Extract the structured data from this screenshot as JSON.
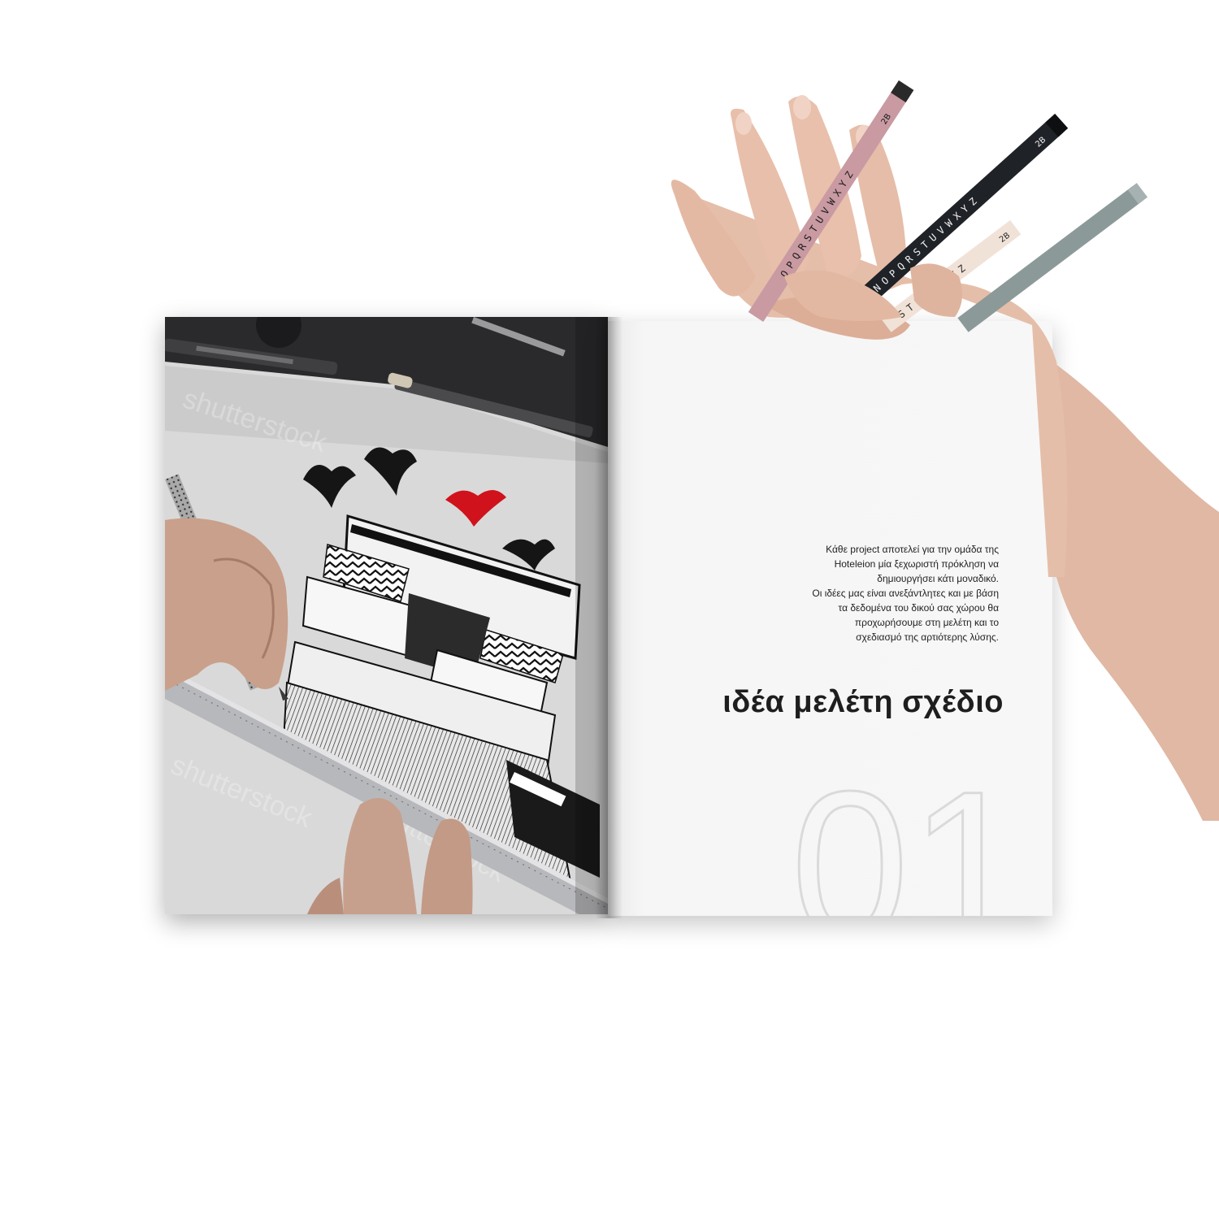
{
  "brochure": {
    "right_page": {
      "intro_lines": [
        "Κάθε project αποτελεί για την ομάδα της",
        "Hoteleion μία ξεχωριστή πρόκληση να",
        "δημιουργήσει κάτι μοναδικό.",
        "Οι ιδέες μας είναι ανεξάντλητες και με βάση",
        "τα δεδομένα του δικού σας χώρου θα",
        "προχωρήσουμε στη μελέτη και το",
        "σχεδιασμό της αρτιότερης λύσης."
      ],
      "headline": "ιδέα μελέτη σχέδιο",
      "page_number": "01"
    },
    "left_page": {
      "watermark": "shutterstock"
    }
  },
  "pencils": {
    "pink": {
      "letters": "OPQRSTUVWXYZ",
      "grade": "2B",
      "color": "#c99aa2"
    },
    "black": {
      "letters": "MNOPQRSTUVWXYZ",
      "grade": "2B",
      "color": "#1f2227"
    },
    "cream": {
      "letters": "STUVWXYZ",
      "grade": "2B",
      "color": "#f1e2d8"
    },
    "sage": {
      "color": "#8b9a99"
    }
  }
}
